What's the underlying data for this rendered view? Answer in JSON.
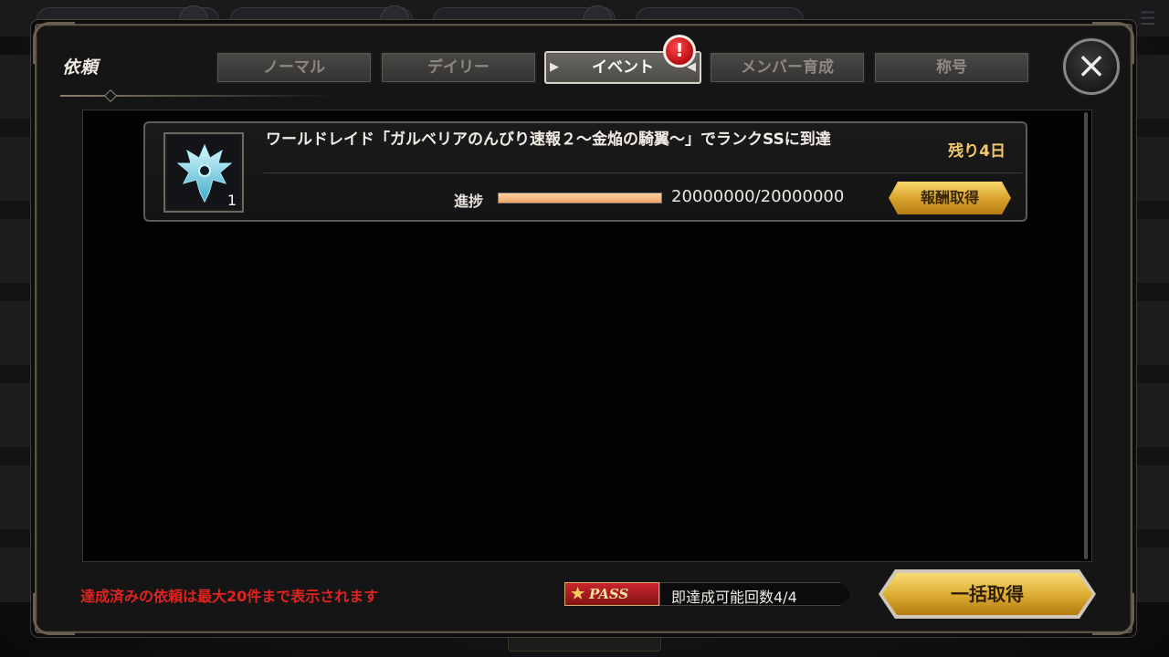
{
  "dialog": {
    "title": "依頼"
  },
  "tabs": [
    {
      "label": "ノーマル",
      "active": false
    },
    {
      "label": "デイリー",
      "active": false
    },
    {
      "label": "イベント",
      "active": true
    },
    {
      "label": "メンバー育成",
      "active": false
    },
    {
      "label": "称号",
      "active": false
    }
  ],
  "alert_badge": "!",
  "close_icon": "×",
  "quests": [
    {
      "icon": "crest-icon",
      "item_count": "1",
      "title": "ワールドレイド「ガルベリアのんびり速報２～金焔の騎翼～」でランクSSに到達",
      "remaining": "残り4日",
      "progress_label": "進捗",
      "progress_value": "20000000/20000000",
      "progress_fraction": 1.0,
      "reward_button": "報酬取得"
    }
  ],
  "footer": {
    "note": "達成済みの依頼は最大20件まで表示されます",
    "pass_label": "PASS",
    "pass_count": "即達成可能回数4/4",
    "claim_all_button": "一括取得"
  },
  "colors": {
    "gold_button": "#dba92f",
    "warning_red": "#e0231f",
    "remaining_gold": "#f2c86a",
    "progress_fill": "#f0a466"
  }
}
